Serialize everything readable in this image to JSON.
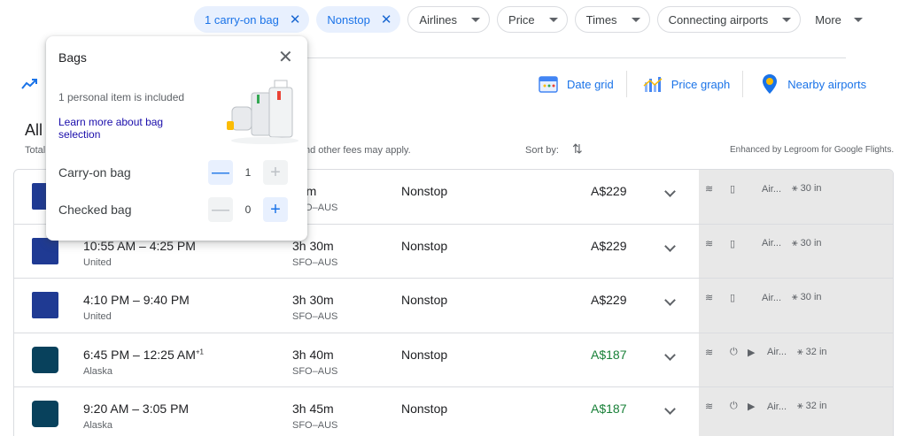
{
  "filters": {
    "active": [
      {
        "label": "1 carry-on bag"
      },
      {
        "label": "Nonstop"
      }
    ],
    "dropdowns": [
      {
        "label": "Airlines"
      },
      {
        "label": "Price"
      },
      {
        "label": "Times"
      },
      {
        "label": "Connecting airports"
      }
    ],
    "more_label": "More",
    "clear_glyph": "✕"
  },
  "tools": {
    "date_grid": "Date grid",
    "price_graph": "Price graph",
    "nearby_airports": "Nearby airports"
  },
  "results": {
    "heading": "All",
    "total_prefix": "Total",
    "fees_note": "nd other fees may apply.",
    "sort_label": "Sort by:",
    "enhanced_note": "Enhanced by Legroom for Google Flights."
  },
  "bags_popover": {
    "title": "Bags",
    "info": "1 personal item is included",
    "learn_more": "Learn more about bag selection",
    "carry_on": {
      "label": "Carry-on bag",
      "value": "1"
    },
    "checked": {
      "label": "Checked bag",
      "value": "0"
    },
    "minus_glyph": "—",
    "plus_glyph": "+"
  },
  "flights": [
    {
      "times": "",
      "carrier": "",
      "duration": "23m",
      "route": "SFO–AUS",
      "stops": "Nonstop",
      "price": "A$229",
      "cheap": false,
      "airline": "united",
      "amenities": {
        "air": "Air...",
        "legroom": "30 in"
      }
    },
    {
      "times": "10:55 AM – 4:25 PM",
      "carrier": "United",
      "duration": "3h 30m",
      "route": "SFO–AUS",
      "stops": "Nonstop",
      "price": "A$229",
      "cheap": false,
      "airline": "united",
      "amenities": {
        "air": "Air...",
        "legroom": "30 in"
      }
    },
    {
      "times": "4:10 PM – 9:40 PM",
      "carrier": "United",
      "duration": "3h 30m",
      "route": "SFO–AUS",
      "stops": "Nonstop",
      "price": "A$229",
      "cheap": false,
      "airline": "united",
      "amenities": {
        "air": "Air...",
        "legroom": "30 in"
      }
    },
    {
      "times": "6:45 PM – 12:25 AM",
      "plus_day": "+1",
      "carrier": "Alaska",
      "duration": "3h 40m",
      "route": "SFO–AUS",
      "stops": "Nonstop",
      "price": "A$187",
      "cheap": true,
      "airline": "alaska",
      "amenities": {
        "air": "Air...",
        "legroom": "32 in"
      }
    },
    {
      "times": "9:20 AM – 3:05 PM",
      "carrier": "Alaska",
      "duration": "3h 45m",
      "route": "SFO–AUS",
      "stops": "Nonstop",
      "price": "A$187",
      "cheap": true,
      "airline": "alaska",
      "amenities": {
        "air": "Air...",
        "legroom": "32 in"
      }
    }
  ],
  "colors": {
    "accent": "#1a73e8",
    "cheap_price": "#188038",
    "united": "#1f3a93",
    "alaska": "#08415c"
  }
}
